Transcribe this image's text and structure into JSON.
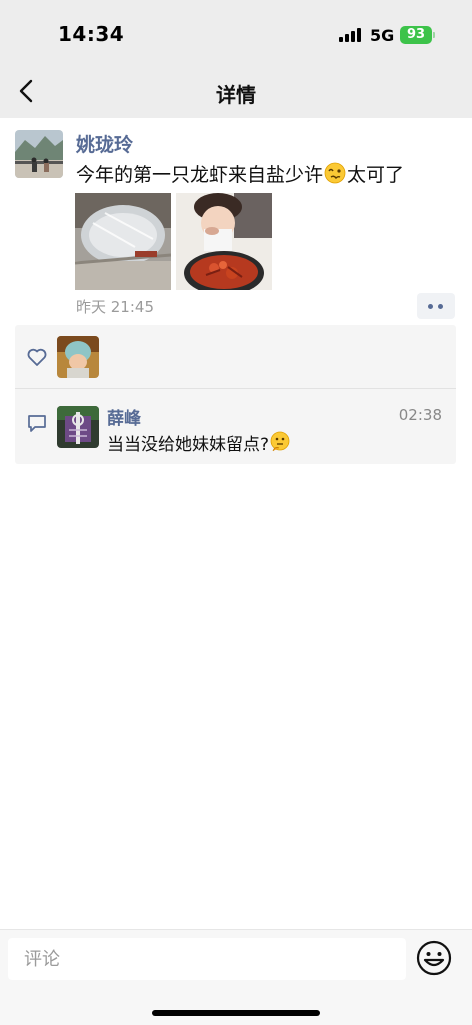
{
  "status_bar": {
    "time": "14:34",
    "network": "5G",
    "battery": "93"
  },
  "nav": {
    "title": "详情",
    "back_icon": "chevron-left-icon"
  },
  "post": {
    "author": "姚珑玲",
    "text_before_emoji": "今年的第一只龙虾来自盐少许",
    "emoji": "woozy-face-emoji",
    "text_after_emoji": "太可了",
    "photos": [
      "crawfish-package-photo",
      "girl-eating-crawfish-photo"
    ],
    "time": "昨天 21:45"
  },
  "likes": {
    "icon": "heart-icon",
    "avatars": [
      "child-helmet-avatar"
    ]
  },
  "comments": [
    {
      "name": "薛峰",
      "time": "02:38",
      "text": "当当没给她妹妹留点?",
      "emoji": "thinking-face-emoji"
    }
  ],
  "composer": {
    "placeholder": "评论",
    "emoji_button": "smiley-face-icon"
  },
  "colors": {
    "link": "#576b95",
    "battery": "#3dc34a",
    "header_bg": "#ededed"
  }
}
